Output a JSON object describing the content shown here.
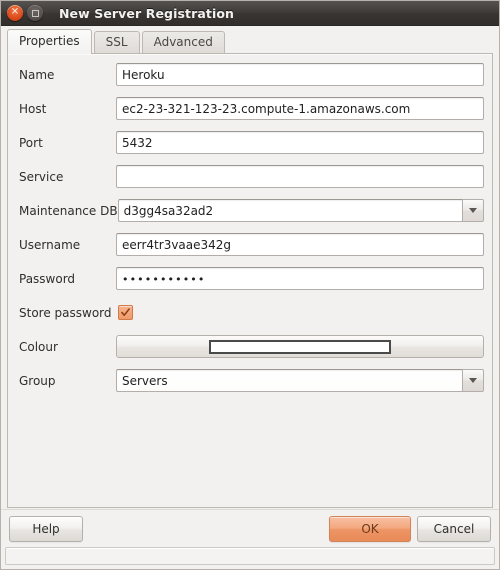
{
  "window": {
    "title": "New Server Registration",
    "close_icon": "close-icon",
    "maximize_icon": "maximize-icon"
  },
  "tabs": [
    {
      "label": "Properties",
      "active": true
    },
    {
      "label": "SSL",
      "active": false
    },
    {
      "label": "Advanced",
      "active": false
    }
  ],
  "form": {
    "fields": [
      {
        "label": "Name",
        "value": "Heroku",
        "type": "text"
      },
      {
        "label": "Host",
        "value": "ec2-23-321-123-23.compute-1.amazonaws.com",
        "type": "text"
      },
      {
        "label": "Port",
        "value": "5432",
        "type": "text"
      },
      {
        "label": "Service",
        "value": "",
        "type": "text"
      },
      {
        "label": "Maintenance DB",
        "value": "d3gg4sa32ad2",
        "type": "combo"
      },
      {
        "label": "Username",
        "value": "eerr4tr3vaae342g",
        "type": "text"
      },
      {
        "label": "Password",
        "value": "•••••••••••",
        "type": "password"
      },
      {
        "label": "Store password",
        "value": "checked",
        "type": "checkbox"
      },
      {
        "label": "Colour",
        "value": "#ffffff",
        "type": "colour"
      },
      {
        "label": "Group",
        "value": "Servers",
        "type": "combo"
      }
    ]
  },
  "buttons": {
    "help": "Help",
    "ok": "OK",
    "cancel": "Cancel"
  },
  "statusbar": {
    "text": ""
  },
  "colors": {
    "accent_orange": "#ee9566",
    "titlebar_dark": "#3a3633",
    "panel_bg": "#f2f1f0",
    "swatch": "#ffffff"
  }
}
